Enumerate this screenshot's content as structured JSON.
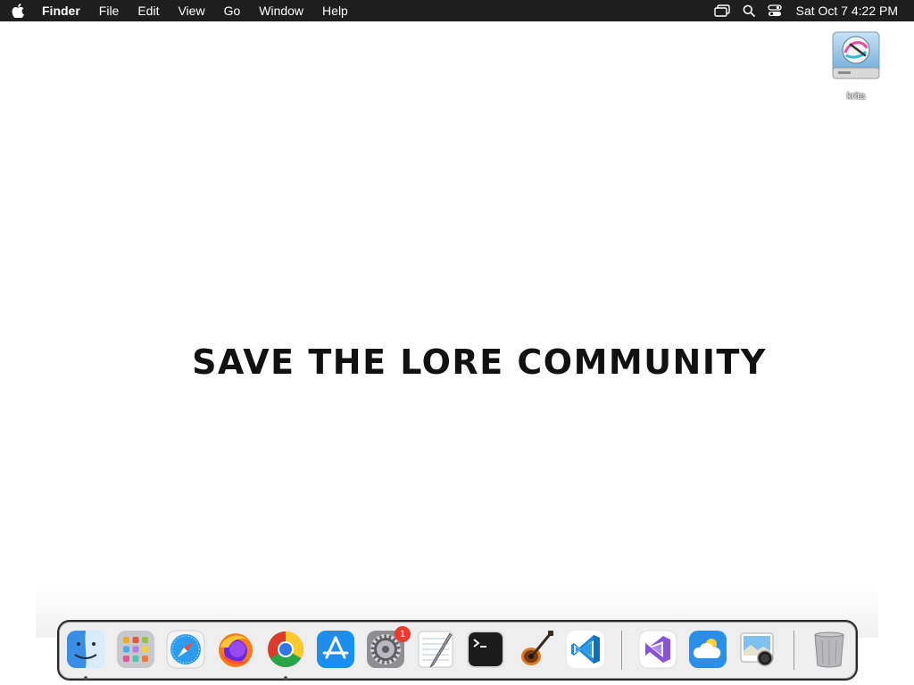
{
  "menubar": {
    "app_name": "Finder",
    "menus": [
      "File",
      "Edit",
      "View",
      "Go",
      "Window",
      "Help"
    ],
    "clock": "Sat Oct 7  4:22 PM"
  },
  "desktop": {
    "icon_label": "krita",
    "headline": "SAVE THE LORE COMMUNITY"
  },
  "dock": {
    "apps": [
      "Finder",
      "Launchpad",
      "Safari",
      "Firefox",
      "Chrome",
      "App Store",
      "System Settings",
      "TextEdit",
      "Terminal",
      "GarageBand",
      "Visual Studio Code",
      "Visual Studio",
      "Weather",
      "Preview",
      "Trash"
    ],
    "settings_badge": "1"
  }
}
